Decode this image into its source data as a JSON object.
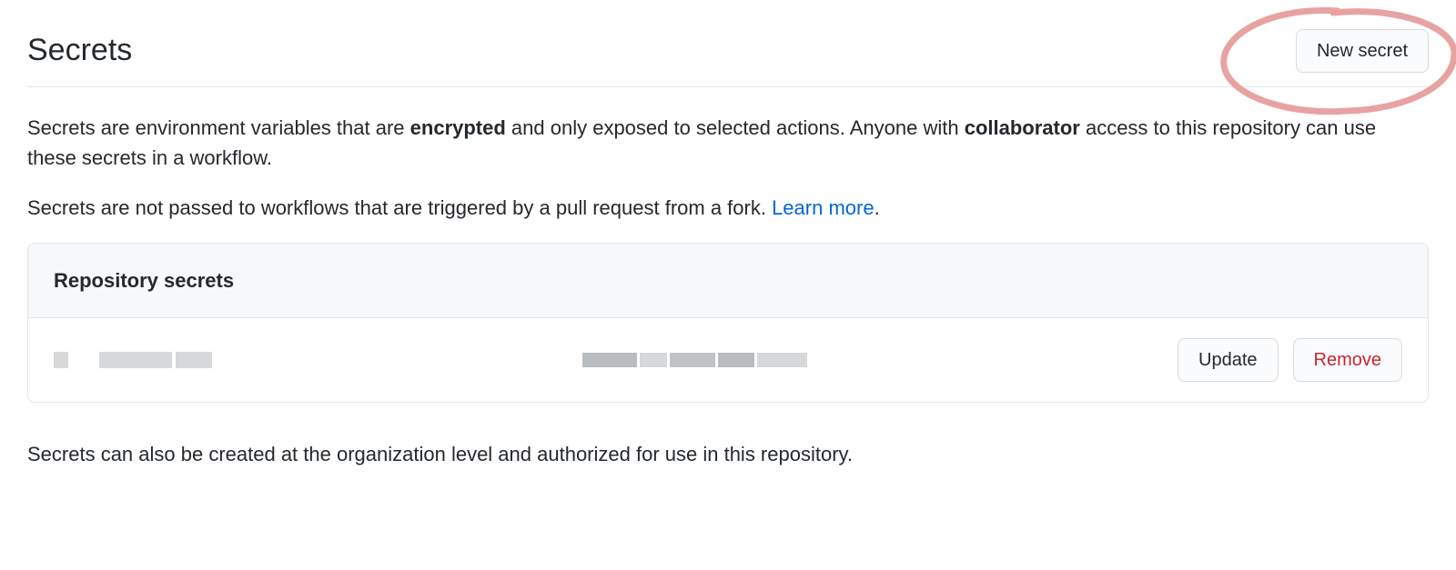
{
  "header": {
    "title": "Secrets",
    "new_secret_label": "New secret"
  },
  "description": {
    "p1_pre": "Secrets are environment variables that are ",
    "p1_bold1": "encrypted",
    "p1_mid": " and only exposed to selected actions. Anyone with ",
    "p1_bold2": "collaborator",
    "p1_post": " access to this repository can use these secrets in a workflow.",
    "p2_text": "Secrets are not passed to workflows that are triggered by a pull request from a fork. ",
    "p2_link": "Learn more",
    "p2_period": "."
  },
  "secrets_box": {
    "heading": "Repository secrets",
    "update_label": "Update",
    "remove_label": "Remove"
  },
  "footer": {
    "note": "Secrets can also be created at the organization level and authorized for use in this repository."
  }
}
